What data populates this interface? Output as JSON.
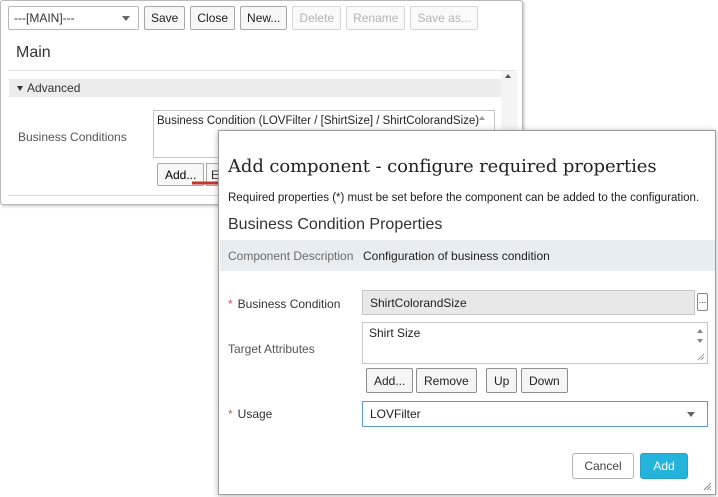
{
  "toolbar": {
    "config_select_value": "---[MAIN]---",
    "save_label": "Save",
    "close_label": "Close",
    "new_label": "New...",
    "delete_label": "Delete",
    "rename_label": "Rename",
    "save_as_label": "Save as..."
  },
  "main": {
    "title": "Main",
    "advanced_label": "Advanced",
    "business_conditions_label": "Business Conditions",
    "business_conditions_items": [
      "Business Condition (LOVFilter / [ShirtSize] / ShirtColorandSize)"
    ],
    "add_label": "Add...",
    "partial_button_label": "E"
  },
  "dialog": {
    "title": "Add component - configure required properties",
    "subtitle": "Required properties (*) must be set before the component can be added to the configuration.",
    "section_title": "Business Condition Properties",
    "description_label": "Component Description",
    "description_value": "Configuration of business condition",
    "required_marker": "*",
    "business_condition_label": "Business Condition",
    "business_condition_value": "ShirtColorandSize",
    "ellipsis_label": "...",
    "target_attributes_label": "Target Attributes",
    "target_attributes_value": "Shirt Size",
    "ta_add_label": "Add...",
    "ta_remove_label": "Remove",
    "ta_up_label": "Up",
    "ta_down_label": "Down",
    "usage_label": "Usage",
    "usage_value": "LOVFilter",
    "cancel_label": "Cancel",
    "add_label": "Add"
  },
  "colors": {
    "accent": "#24b3da",
    "required": "#d9534f",
    "arrow": "#c0392b",
    "description_row": "#e7edf1"
  }
}
